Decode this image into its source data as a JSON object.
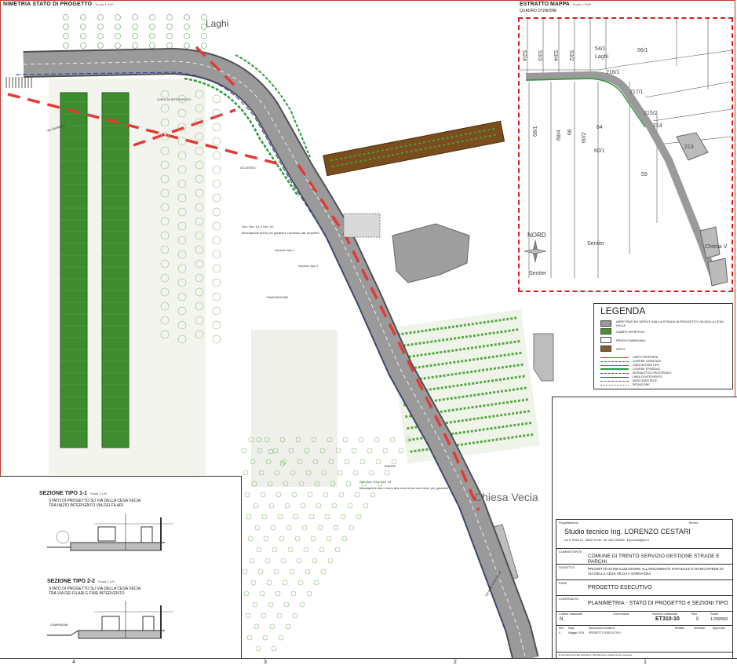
{
  "header": {
    "title": "NIMETRIA STATO DI PROGETTO",
    "scale": "Scala 1:500"
  },
  "map": {
    "place_laghi": "Laghi",
    "place_chiesa": "Chiesa Vecia",
    "colors": {
      "road": "#9a9a9a",
      "road_edge": "#505050",
      "hedge": "#2e7d32",
      "field": "#4e8f2b",
      "orchard": "#6a3d1a",
      "grass": "#e8e8e8",
      "red_dash": "#e53935",
      "blue_line": "#1f3ea8"
    },
    "labels": [
      "Via Sardagna",
      "Via della Cesa Vecia",
      "Ora. Sez. 01 e Sez. 02",
      "Marciapiede bordo per garantire l'accesso alle proprietà",
      "Sezione tipo 1",
      "Sezione tipo 2",
      "ACCESSO",
      "RAMPA",
      "Ora. Sez. 03 e Sez. 04",
      "Marciapiede alto e muro alla cesa Vecia con bordo per garantire",
      "LINEA DI INTERVENTO",
      "PIANTAGIONE"
    ]
  },
  "estratto": {
    "title": "ESTRATTO MAPPA",
    "scale": "Scala 1:1000",
    "subtitle": "QUADRO D'UNIONE",
    "place_laghi": "Laghi",
    "north": "NORD",
    "parcels": [
      "52/4",
      "53/3",
      "53/4",
      "53/2",
      "54/1",
      "56/1",
      "216/1",
      "217/1",
      "215/2",
      "214",
      "68/1",
      "68/4",
      "66",
      "60/2",
      "64",
      "60/1",
      "59",
      "213"
    ],
    "places": [
      "Sentier",
      "Sentier",
      "Chiesa V"
    ]
  },
  "legend": {
    "title": "LEGENDA",
    "items": [
      {
        "label": "ARRETRATORI SERVITI DALLA STRADA IN PROGETTO VIA DELLA CESA VECIA",
        "color": "#9a9a9a"
      },
      {
        "label": "CAMPO SPORTIVO",
        "color": "#4e8f2b"
      },
      {
        "label": "PRATO/CAMPAGNA",
        "color": "#ffffff"
      },
      {
        "label": "ORTO",
        "color": "#8a5a2b"
      }
    ],
    "lines": [
      "LIMITE PROPRIETA",
      "CONFINE CATASTALE",
      "LINEA SEZIONI TIPO",
      "CONFINE STRADALE",
      "SEGNALETICA ORIZZONTALE",
      "LINEA DI INTERVENTO",
      "MURO ESISTENTE",
      "RECINZIONE"
    ]
  },
  "sections": {
    "s1_title": "SEZIONE TIPO  1-1",
    "s1_scale": "Scala 1:100",
    "s1_desc": "STATO DI PROGETTO  SU VIA DELLA CESA VECIA TRA INIZIO INTERVENTO VIA DEI FILARI",
    "s2_title": "SEZIONE TIPO  2-2",
    "s2_scale": "Scala 1:100",
    "s2_desc": "STATO DI PROGETTO  SU VIA DELLA CESA VECIA TRA VIA DEI FILARI E FINE INTERVENTO",
    "campagna": "CAMPAGNA"
  },
  "titleblock": {
    "lbl_progettista": "Progettazione",
    "lbl_timbro": "Timbro",
    "progettista": "Studio tecnico Ing. LORENZO CESTARI",
    "progettista_addr": "via S. Pietro 13 - 38100 Trento - tel. 0461 000000 - ing.cestari@pec.it",
    "lbl_committente": "COMMITTENTE",
    "committente": "COMUNE DI TRENTO-SERVIZIO GESTIONE  STRADE E PARCHI",
    "lbl_oggetto": "OGGETTO",
    "oggetto": "PROGETTO DI REALIZZAZIONE ALLARGAMENTO STRADALE E MARCIAPIEDE IN VIA DELLA CESA VECIA A SARDAGNA",
    "lbl_fase": "FASE",
    "fase": "PROGETTO ESECUTIVO",
    "lbl_contenuto": "CONTENUTO",
    "contenuto": "PLANIMETRIA - STATO DI PROGETTO e SEZIONI TIPO",
    "lbl_codice": "Codice elaborato",
    "lbl_commessa": "Commessa",
    "lbl_numero": "Numero elaborato",
    "lbl_rev": "Rev.",
    "lbl_scala": "Scala",
    "codice": "N.",
    "numero": "ET310-10",
    "rev": "0",
    "scala": "1:200/500",
    "table_head": [
      "Rev.",
      "Data",
      "Descrizione revisione",
      "Redatto",
      "Verificato",
      "Approvato"
    ],
    "table_row": [
      "0",
      "Maggio 2019",
      "PROGETTO ESECUTIVO",
      "",
      "",
      ""
    ],
    "footer": "È proprietà riservata dell'autore. Riproduzione vietata senza consenso."
  },
  "band": {
    "cells": [
      "4",
      "3",
      "2",
      "1"
    ]
  }
}
